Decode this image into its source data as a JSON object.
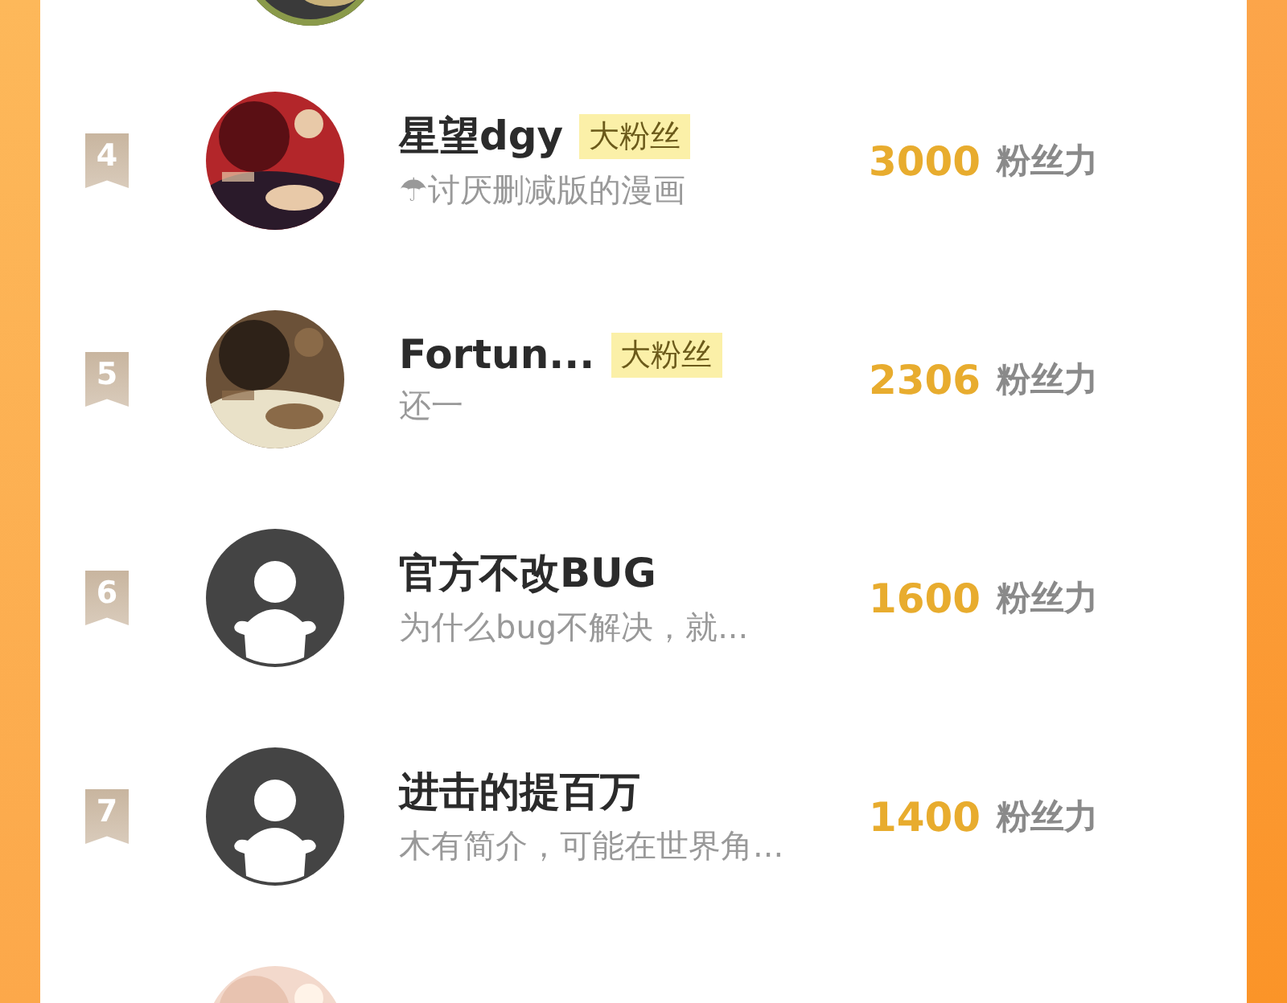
{
  "rows": [
    {
      "avatar": {
        "kind": "picture"
      }
    },
    {
      "rank": "4",
      "avatar": {
        "kind": "picture"
      },
      "name": "星望dgy",
      "badge": "大粉丝",
      "bio": "☂讨厌删减版的漫画",
      "score": "3000",
      "unit": "粉丝力"
    },
    {
      "rank": "5",
      "avatar": {
        "kind": "picture"
      },
      "name": "Fortun...",
      "badge": "大粉丝",
      "bio": "还一",
      "score": "2306",
      "unit": "粉丝力"
    },
    {
      "rank": "6",
      "avatar": {
        "kind": "default"
      },
      "name": "官方不改BUG",
      "bio": "为什么bug不解决，就...",
      "score": "1600",
      "unit": "粉丝力"
    },
    {
      "rank": "7",
      "avatar": {
        "kind": "default"
      },
      "name": "进击的提百万",
      "bio": "木有简介，可能在世界角...",
      "score": "1400",
      "unit": "粉丝力"
    },
    {
      "avatar": {
        "kind": "picture"
      }
    }
  ]
}
